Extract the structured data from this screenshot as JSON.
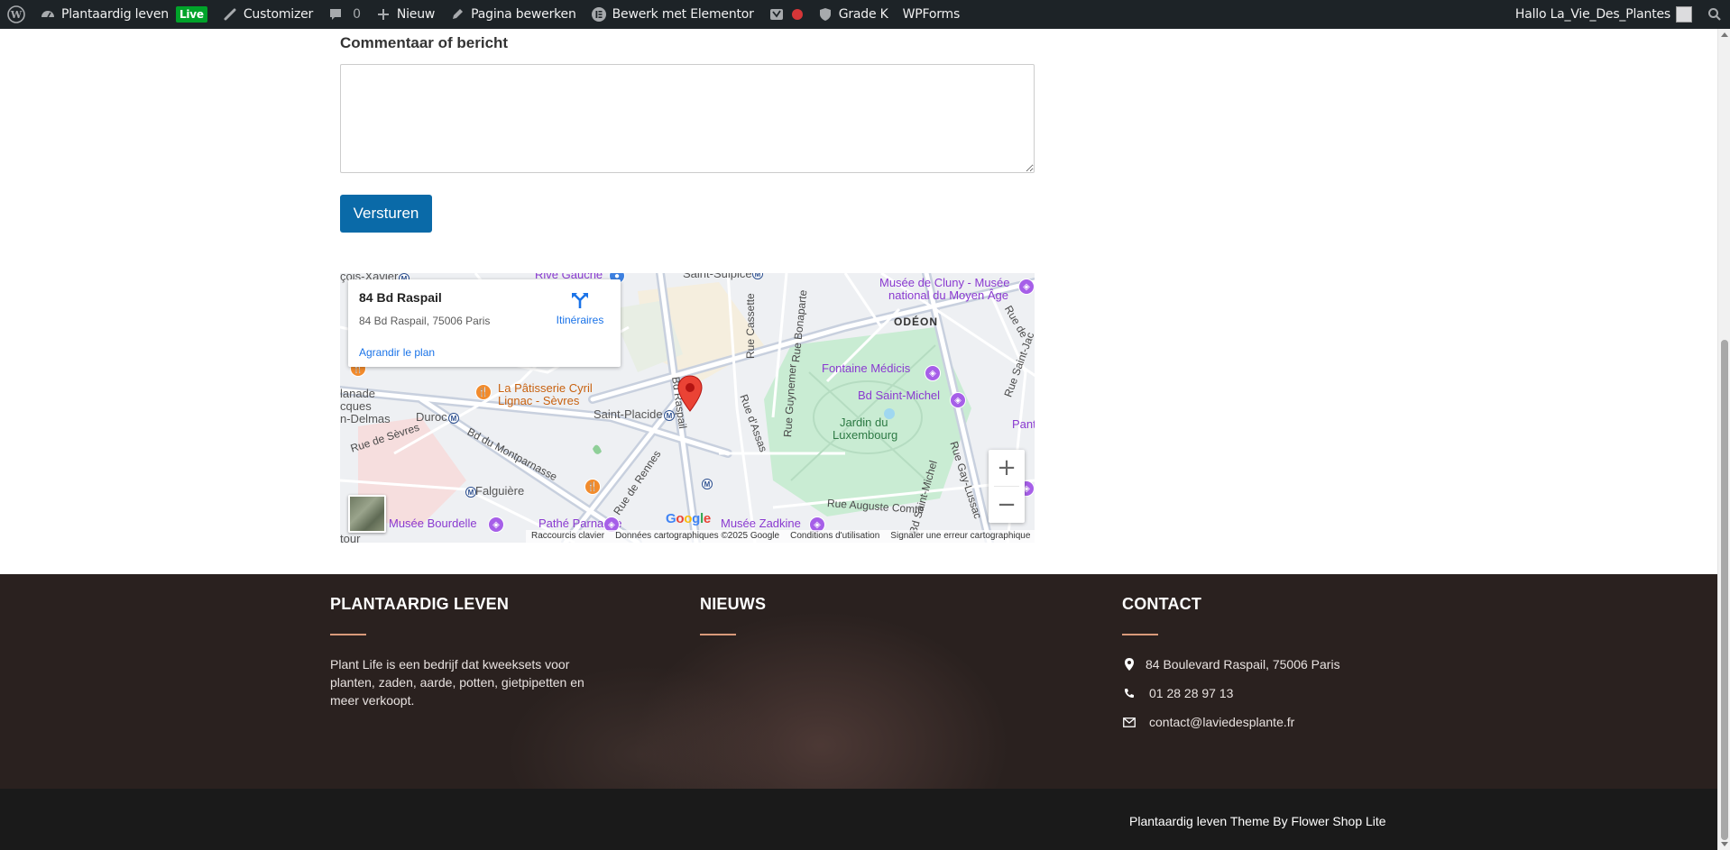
{
  "adminbar": {
    "site_name": "Plantaardig leven",
    "live_badge": "Live",
    "customizer": "Customizer",
    "comments_count": "0",
    "new": "Nieuw",
    "edit_page": "Pagina bewerken",
    "elementor": "Bewerk met Elementor",
    "grade": "Grade K",
    "wpforms": "WPForms",
    "greeting": "Hallo La_Vie_Des_Plantes"
  },
  "form": {
    "comment_label": "Commentaar of bericht",
    "comment_value": "",
    "submit_label": "Versturen"
  },
  "map": {
    "place_name": "84 Bd Raspail",
    "place_address": "84 Bd Raspail, 75006 Paris",
    "directions_label": "Itinéraires",
    "enlarge_label": "Agrandir le plan",
    "zoom_in": "+",
    "zoom_out": "−",
    "google_logo": "Google",
    "footer_links": [
      "Raccourcis clavier",
      "Données cartographiques ©2025 Google",
      "Conditions d'utilisation",
      "Signaler une erreur cartographique"
    ],
    "labels": {
      "rive_gauche": "Rive Gauche",
      "saint_sulpice": "Saint-Sulpice",
      "cluny": "Musée de Cluny - Musée",
      "cluny2": "national du Moyen Âge",
      "odeon": "ODÉON",
      "fontaine_medicis": "Fontaine Médicis",
      "bd_saint_michel": "Bd Saint-Michel",
      "jardin1": "Jardin du",
      "jardin2": "Luxembourg",
      "patisserie1": "La Pâtisserie Cyril",
      "patisserie2": "Lignac - Sèvres",
      "saint_placide": "Saint-Placide",
      "duroc": "Duroc",
      "rue_de_sevres": "Rue de Sèvres",
      "bd_montparnasse": "Bd du Montparnasse",
      "falguiere": "Falguière",
      "rue_de_rennes": "Rue de Rennes",
      "bd_raspail": "Bd Raspail",
      "rue_cassette": "Rue Cassette",
      "rue_bonaparte": "Rue Bonaparte",
      "rue_guynemer": "Rue Guynemer",
      "rue_assas": "Rue d'Assas",
      "rue_auguste_comte": "Rue Auguste Comte",
      "bd_saint_michel_v": "Bd Saint-Michel",
      "rue_gay_lussac": "Rue Gay-Lussac",
      "musee_bourdelle": "Musée Bourdelle",
      "pathe": "Pathé Parnasse",
      "zadkine": "Musée Zadkine",
      "xavier": "çois-Xavier",
      "lanade": "lanade",
      "cques": "cques",
      "delmas": "n-Delmas",
      "pant": "Pant",
      "rue_de_edge": "Rue de",
      "rue_saint_jac": "Rue Saint-Jac",
      "tour": "tour"
    }
  },
  "footer": {
    "col1_title": "PLANTAARDIG LEVEN",
    "col1_text": "Plant Life is een bedrijf dat kweeksets voor planten, zaden, aarde, potten, gietpipetten en meer verkoopt.",
    "col2_title": "NIEUWS",
    "col3_title": "CONTACT",
    "address": "84 Boulevard Raspail, 75006 Paris",
    "phone": "01 28 28 97 13",
    "email": "contact@laviedesplante.fr",
    "copyright": "Plantaardig leven Theme By Flower Shop Lite"
  }
}
